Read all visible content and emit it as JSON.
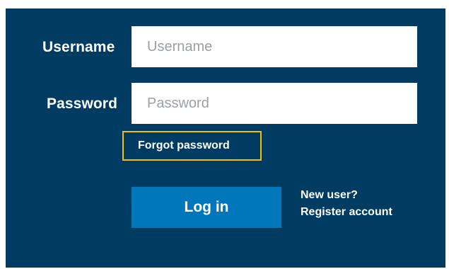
{
  "form": {
    "username": {
      "label": "Username",
      "placeholder": "Username",
      "value": ""
    },
    "password": {
      "label": "Password",
      "placeholder": "Password",
      "value": ""
    },
    "forgot_password": "Forgot password",
    "login_button": "Log in",
    "new_user_text": "New user?",
    "register_link": "Register account"
  },
  "colors": {
    "panel_background": "#003b62",
    "button_background": "#0077bb",
    "focus_outline": "#f2c200",
    "text": "#ffffff",
    "placeholder": "#9aa0a6"
  }
}
